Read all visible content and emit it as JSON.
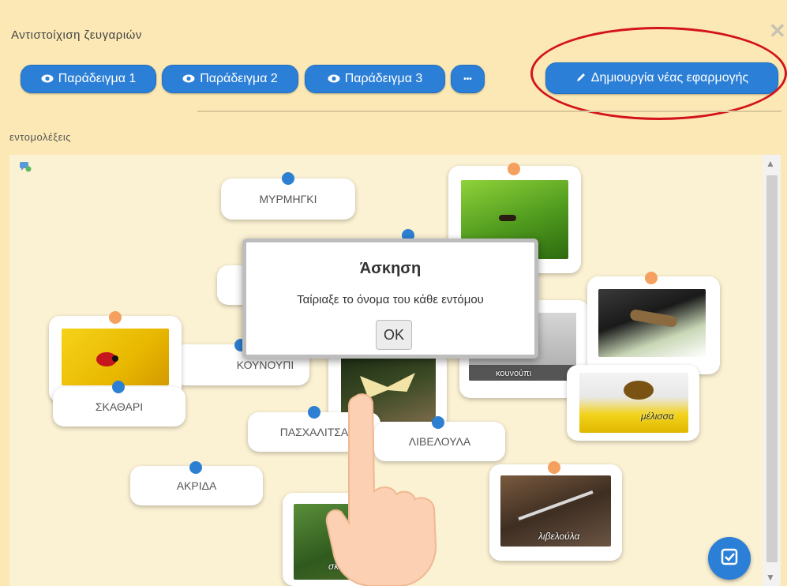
{
  "header": {
    "title": "Αντιστοίχιση ζευγαριών",
    "subtitle": "εντομολέξεις"
  },
  "toolbar": {
    "example1": "Παράδειγμα 1",
    "example2": "Παράδειγμα 2",
    "example3": "Παράδειγμα 3",
    "more": "•••",
    "create": "Δημιουργία νέας εφαρμογής"
  },
  "words": {
    "w1": "ΜΥΡΜΗΓΚΙ",
    "w2": "ΚΟΥΝΟΥΠΙ",
    "w3": "ΣΚΑΘΑΡΙ",
    "w4": "ΠΑΣΧΑΛΙΤΣΑ",
    "w5": "ΛΙΒΕΛΟΥΛΑ",
    "w6": "ΑΚΡΙΔΑ"
  },
  "photo_labels": {
    "p1": "κουνούπι",
    "p2": "μέλισσα",
    "p3": "λιβελούλα",
    "p4": "σκαθάρι"
  },
  "modal": {
    "title": "Άσκηση",
    "text": "Ταίριαξε το όνομα του κάθε εντόμου",
    "ok": "OK"
  },
  "colors": {
    "accent": "#2b7fd6",
    "panel_bg": "#fbe8b4",
    "board_bg": "#fbf1d3",
    "annotation": "#d4141a"
  }
}
